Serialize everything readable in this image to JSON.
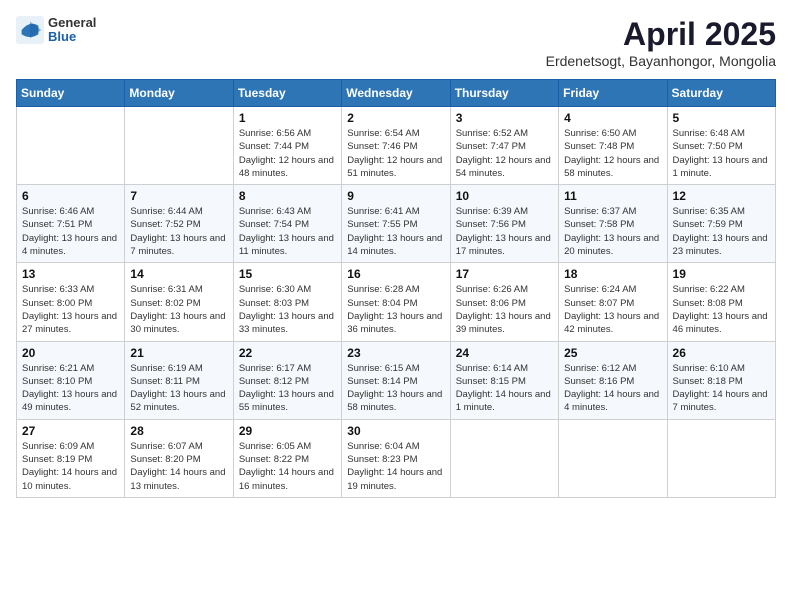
{
  "header": {
    "logo": {
      "general": "General",
      "blue": "Blue"
    },
    "title": "April 2025",
    "subtitle": "Erdenetsogt, Bayanhongor, Mongolia"
  },
  "calendar": {
    "days_of_week": [
      "Sunday",
      "Monday",
      "Tuesday",
      "Wednesday",
      "Thursday",
      "Friday",
      "Saturday"
    ],
    "weeks": [
      [
        {
          "day": "",
          "info": ""
        },
        {
          "day": "",
          "info": ""
        },
        {
          "day": "1",
          "info": "Sunrise: 6:56 AM\nSunset: 7:44 PM\nDaylight: 12 hours and 48 minutes."
        },
        {
          "day": "2",
          "info": "Sunrise: 6:54 AM\nSunset: 7:46 PM\nDaylight: 12 hours and 51 minutes."
        },
        {
          "day": "3",
          "info": "Sunrise: 6:52 AM\nSunset: 7:47 PM\nDaylight: 12 hours and 54 minutes."
        },
        {
          "day": "4",
          "info": "Sunrise: 6:50 AM\nSunset: 7:48 PM\nDaylight: 12 hours and 58 minutes."
        },
        {
          "day": "5",
          "info": "Sunrise: 6:48 AM\nSunset: 7:50 PM\nDaylight: 13 hours and 1 minute."
        }
      ],
      [
        {
          "day": "6",
          "info": "Sunrise: 6:46 AM\nSunset: 7:51 PM\nDaylight: 13 hours and 4 minutes."
        },
        {
          "day": "7",
          "info": "Sunrise: 6:44 AM\nSunset: 7:52 PM\nDaylight: 13 hours and 7 minutes."
        },
        {
          "day": "8",
          "info": "Sunrise: 6:43 AM\nSunset: 7:54 PM\nDaylight: 13 hours and 11 minutes."
        },
        {
          "day": "9",
          "info": "Sunrise: 6:41 AM\nSunset: 7:55 PM\nDaylight: 13 hours and 14 minutes."
        },
        {
          "day": "10",
          "info": "Sunrise: 6:39 AM\nSunset: 7:56 PM\nDaylight: 13 hours and 17 minutes."
        },
        {
          "day": "11",
          "info": "Sunrise: 6:37 AM\nSunset: 7:58 PM\nDaylight: 13 hours and 20 minutes."
        },
        {
          "day": "12",
          "info": "Sunrise: 6:35 AM\nSunset: 7:59 PM\nDaylight: 13 hours and 23 minutes."
        }
      ],
      [
        {
          "day": "13",
          "info": "Sunrise: 6:33 AM\nSunset: 8:00 PM\nDaylight: 13 hours and 27 minutes."
        },
        {
          "day": "14",
          "info": "Sunrise: 6:31 AM\nSunset: 8:02 PM\nDaylight: 13 hours and 30 minutes."
        },
        {
          "day": "15",
          "info": "Sunrise: 6:30 AM\nSunset: 8:03 PM\nDaylight: 13 hours and 33 minutes."
        },
        {
          "day": "16",
          "info": "Sunrise: 6:28 AM\nSunset: 8:04 PM\nDaylight: 13 hours and 36 minutes."
        },
        {
          "day": "17",
          "info": "Sunrise: 6:26 AM\nSunset: 8:06 PM\nDaylight: 13 hours and 39 minutes."
        },
        {
          "day": "18",
          "info": "Sunrise: 6:24 AM\nSunset: 8:07 PM\nDaylight: 13 hours and 42 minutes."
        },
        {
          "day": "19",
          "info": "Sunrise: 6:22 AM\nSunset: 8:08 PM\nDaylight: 13 hours and 46 minutes."
        }
      ],
      [
        {
          "day": "20",
          "info": "Sunrise: 6:21 AM\nSunset: 8:10 PM\nDaylight: 13 hours and 49 minutes."
        },
        {
          "day": "21",
          "info": "Sunrise: 6:19 AM\nSunset: 8:11 PM\nDaylight: 13 hours and 52 minutes."
        },
        {
          "day": "22",
          "info": "Sunrise: 6:17 AM\nSunset: 8:12 PM\nDaylight: 13 hours and 55 minutes."
        },
        {
          "day": "23",
          "info": "Sunrise: 6:15 AM\nSunset: 8:14 PM\nDaylight: 13 hours and 58 minutes."
        },
        {
          "day": "24",
          "info": "Sunrise: 6:14 AM\nSunset: 8:15 PM\nDaylight: 14 hours and 1 minute."
        },
        {
          "day": "25",
          "info": "Sunrise: 6:12 AM\nSunset: 8:16 PM\nDaylight: 14 hours and 4 minutes."
        },
        {
          "day": "26",
          "info": "Sunrise: 6:10 AM\nSunset: 8:18 PM\nDaylight: 14 hours and 7 minutes."
        }
      ],
      [
        {
          "day": "27",
          "info": "Sunrise: 6:09 AM\nSunset: 8:19 PM\nDaylight: 14 hours and 10 minutes."
        },
        {
          "day": "28",
          "info": "Sunrise: 6:07 AM\nSunset: 8:20 PM\nDaylight: 14 hours and 13 minutes."
        },
        {
          "day": "29",
          "info": "Sunrise: 6:05 AM\nSunset: 8:22 PM\nDaylight: 14 hours and 16 minutes."
        },
        {
          "day": "30",
          "info": "Sunrise: 6:04 AM\nSunset: 8:23 PM\nDaylight: 14 hours and 19 minutes."
        },
        {
          "day": "",
          "info": ""
        },
        {
          "day": "",
          "info": ""
        },
        {
          "day": "",
          "info": ""
        }
      ]
    ]
  }
}
